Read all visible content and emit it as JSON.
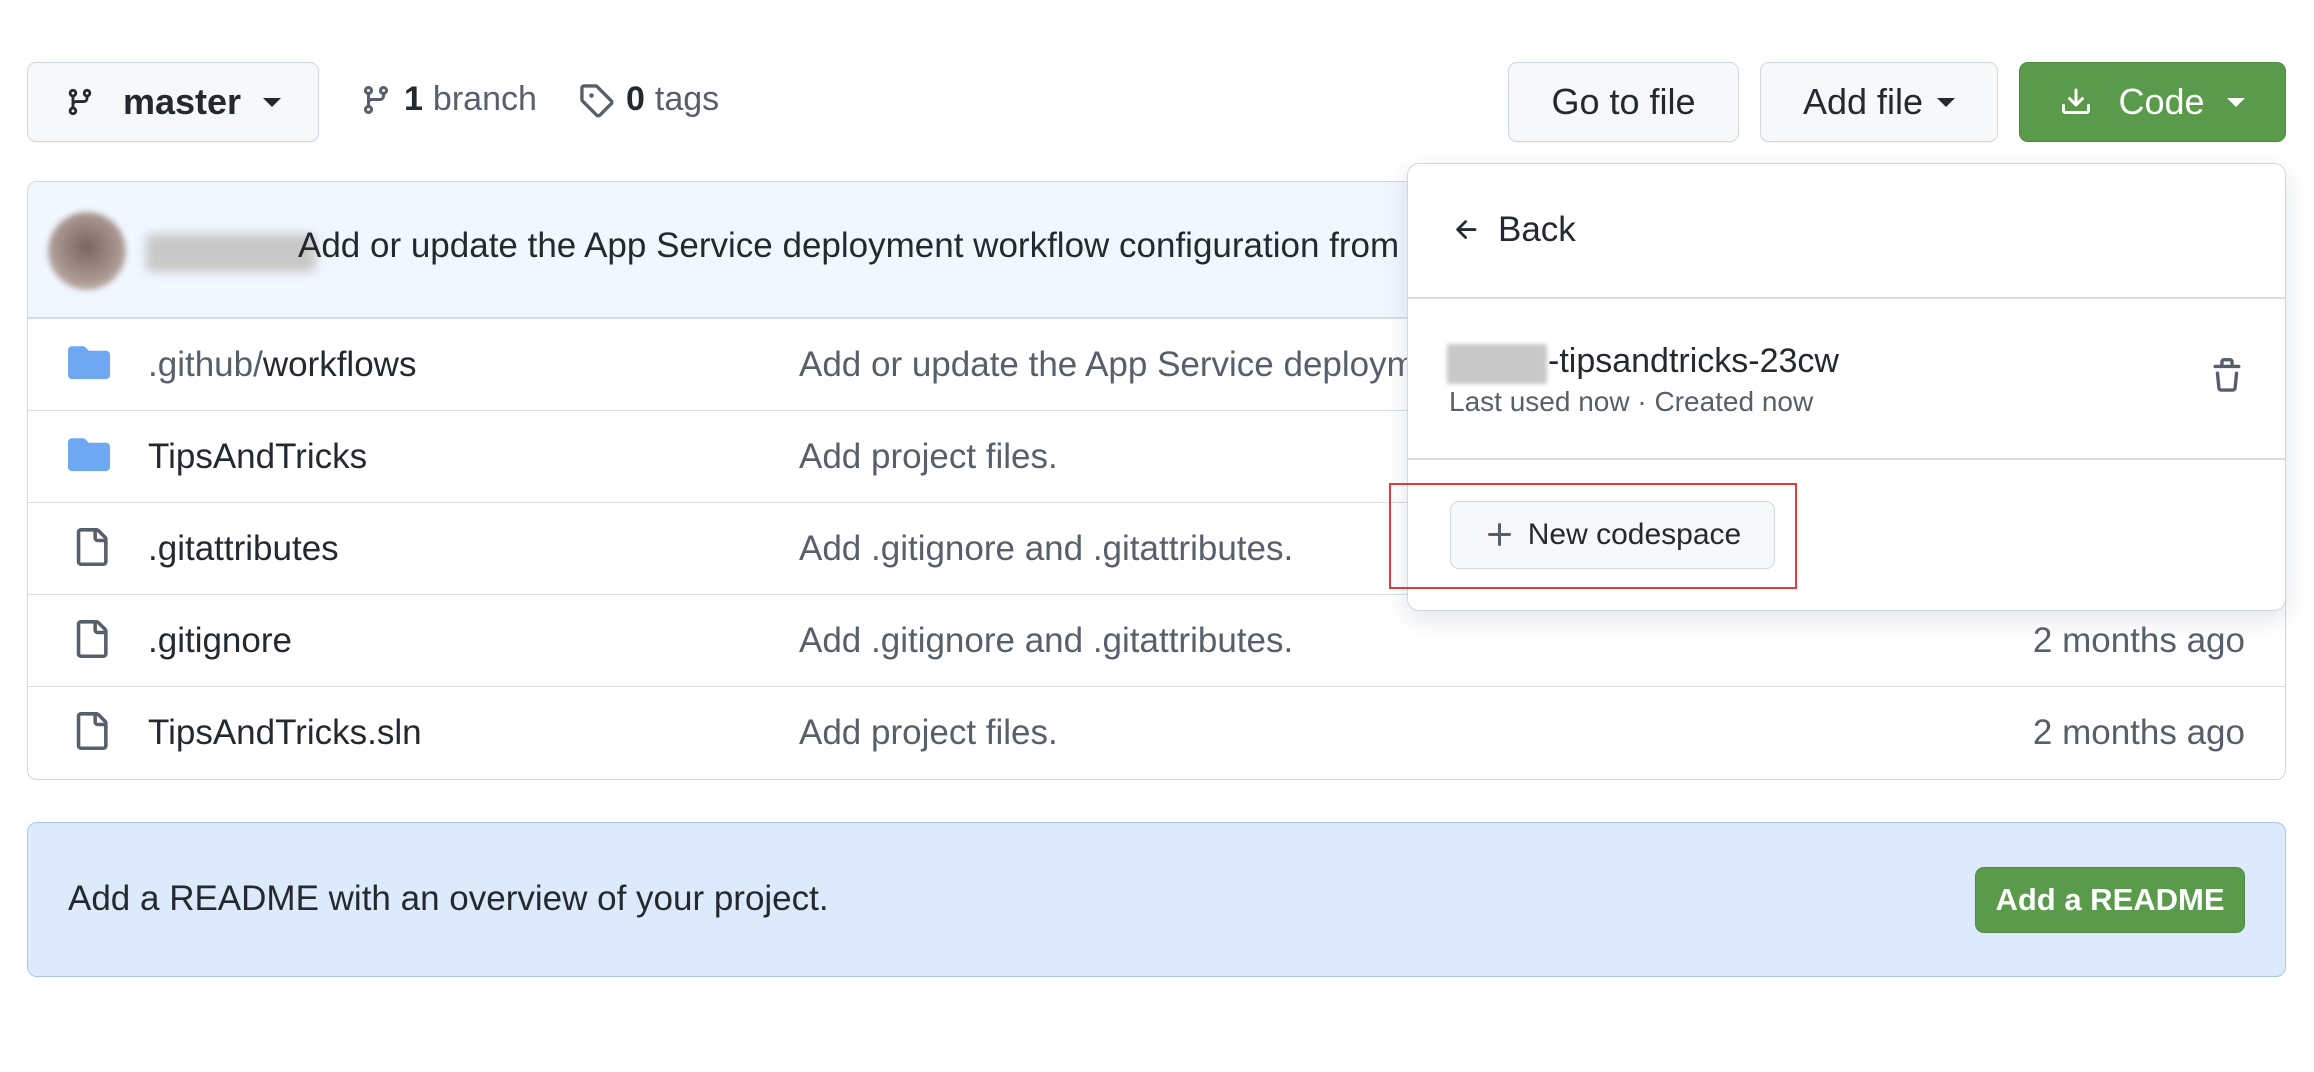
{
  "toolbar": {
    "branch_select": "master",
    "branches_count": "1",
    "branches_label": "branch",
    "tags_count": "0",
    "tags_label": "tags",
    "go_to_file": "Go to file",
    "add_file": "Add file",
    "code": "Code"
  },
  "latest_commit": {
    "message": "Add or update the App Service deployment workflow configuration from"
  },
  "files": [
    {
      "name_prefix": ".github/",
      "name": "workflows",
      "type": "folder",
      "message": "Add or update the App Service deploym",
      "age": ""
    },
    {
      "name_prefix": "",
      "name": "TipsAndTricks",
      "type": "folder",
      "message": "Add project files.",
      "age": ""
    },
    {
      "name_prefix": "",
      "name": ".gitattributes",
      "type": "file",
      "message": "Add .gitignore and .gitattributes.",
      "age": ""
    },
    {
      "name_prefix": "",
      "name": ".gitignore",
      "type": "file",
      "message": "Add .gitignore and .gitattributes.",
      "age": "2 months ago"
    },
    {
      "name_prefix": "",
      "name": "TipsAndTricks.sln",
      "type": "file",
      "message": "Add project files.",
      "age": "2 months ago"
    }
  ],
  "readme_banner": {
    "text": "Add a README with an overview of your project.",
    "button": "Add a README"
  },
  "codespaces_popover": {
    "back": "Back",
    "codespace_name_suffix": "-tipsandtricks-23cw",
    "codespace_meta": "Last used now · Created now",
    "new_codespace": "New codespace"
  },
  "colors": {
    "accent_green": "#5a9a4b",
    "folder_blue": "#6fa8f2",
    "highlight_red": "#e03c3c",
    "banner_bg": "#ddeafc"
  }
}
